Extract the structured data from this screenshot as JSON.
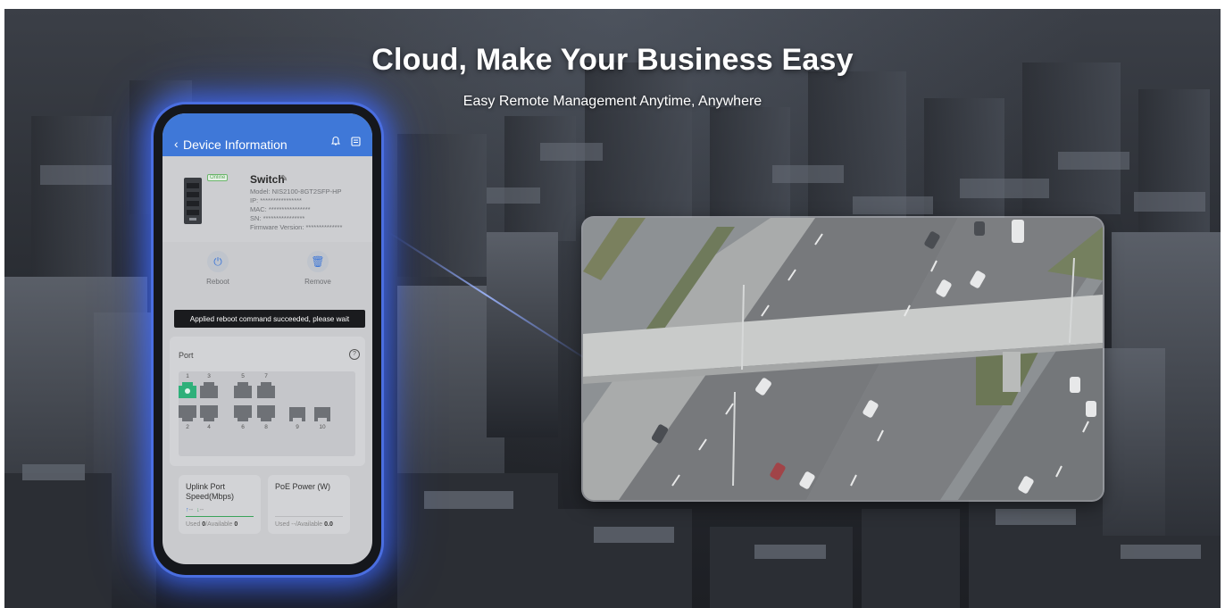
{
  "hero": {
    "title": "Cloud, Make Your Business Easy",
    "subtitle": "Easy Remote Management Anytime, Anywhere"
  },
  "app": {
    "header": {
      "back_icon": "chevron-left-icon",
      "title": "Device Information",
      "bell_icon": "bell-icon",
      "doc_icon": "document-icon"
    },
    "device": {
      "status": "Online",
      "name": "Switch",
      "model": "Model: NIS2100-8GT2SFP-HP",
      "ip": "IP: ****************",
      "mac": "MAC: ****************",
      "sn": "SN: ****************",
      "firmware": "Firmware Version: **************"
    },
    "actions": {
      "reboot_label": "Reboot",
      "remove_label": "Remove"
    },
    "toast": "Applied reboot command succeeded, please wait",
    "ports": {
      "title": "Port",
      "top_labels": [
        "1",
        "3",
        "5",
        "7"
      ],
      "bottom_labels": [
        "2",
        "4",
        "6",
        "8",
        "9",
        "10"
      ],
      "active_port": "1",
      "active_color": "#2fb07a"
    },
    "uplink": {
      "title": "Uplink Port Speed(Mbps)",
      "up": "--",
      "down": "--",
      "used_label": "Used ",
      "used_value": "0",
      "available_label": "/Available ",
      "available_value": "0"
    },
    "poe": {
      "title": "PoE Power (W)",
      "used_label": "Used --/Available ",
      "available_value": "0.0"
    }
  },
  "colors": {
    "accent": "#3f78d8",
    "phone_glow": "#4a6ee0",
    "online": "#5aa95a"
  }
}
